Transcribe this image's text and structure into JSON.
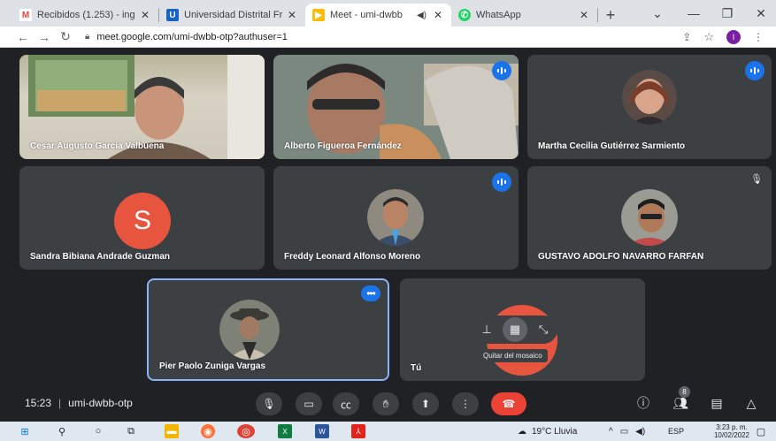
{
  "browser": {
    "tabs": [
      {
        "favicon": "gmail-icon",
        "title": "Recibidos (1.253) - ing",
        "active": false
      },
      {
        "favicon": "university-icon",
        "title": "Universidad Distrital Fr",
        "active": false
      },
      {
        "favicon": "meet-icon",
        "title": "Meet - umi-dwbb",
        "active": true
      },
      {
        "favicon": "whatsapp-icon",
        "title": "WhatsApp",
        "active": false
      }
    ],
    "url": "meet.google.com/umi-dwbb-otp?authuser=1",
    "profile_initial": "I"
  },
  "participants": [
    {
      "name": "Cesar Augusto Garcia Valbuena"
    },
    {
      "name": "Alberto Figueroa Fernández"
    },
    {
      "name": "Martha Cecilia Gutiérrez Sarmiento"
    },
    {
      "name": "Sandra Bibiana Andrade Guzman",
      "initial": "S"
    },
    {
      "name": "Freddy Leonard Alfonso Moreno"
    },
    {
      "name": "GUSTAVO ADOLFO NAVARRO FARFAN"
    },
    {
      "name": "Pier Paolo Zuniga Vargas"
    },
    {
      "name": "Tú"
    }
  ],
  "mosaic_tooltip": "Quitar del mosaico",
  "meeting": {
    "time": "15:23",
    "code": "umi-dwbb-otp",
    "people_count": "8"
  },
  "taskbar": {
    "weather": "19°C Lluvia",
    "lang": "ESP",
    "time": "3:23 p. m.",
    "date": "10/02/2022"
  },
  "colors": {
    "accent": "#1a73e8",
    "end_call": "#ea4335",
    "avatar": "#e8553f"
  }
}
